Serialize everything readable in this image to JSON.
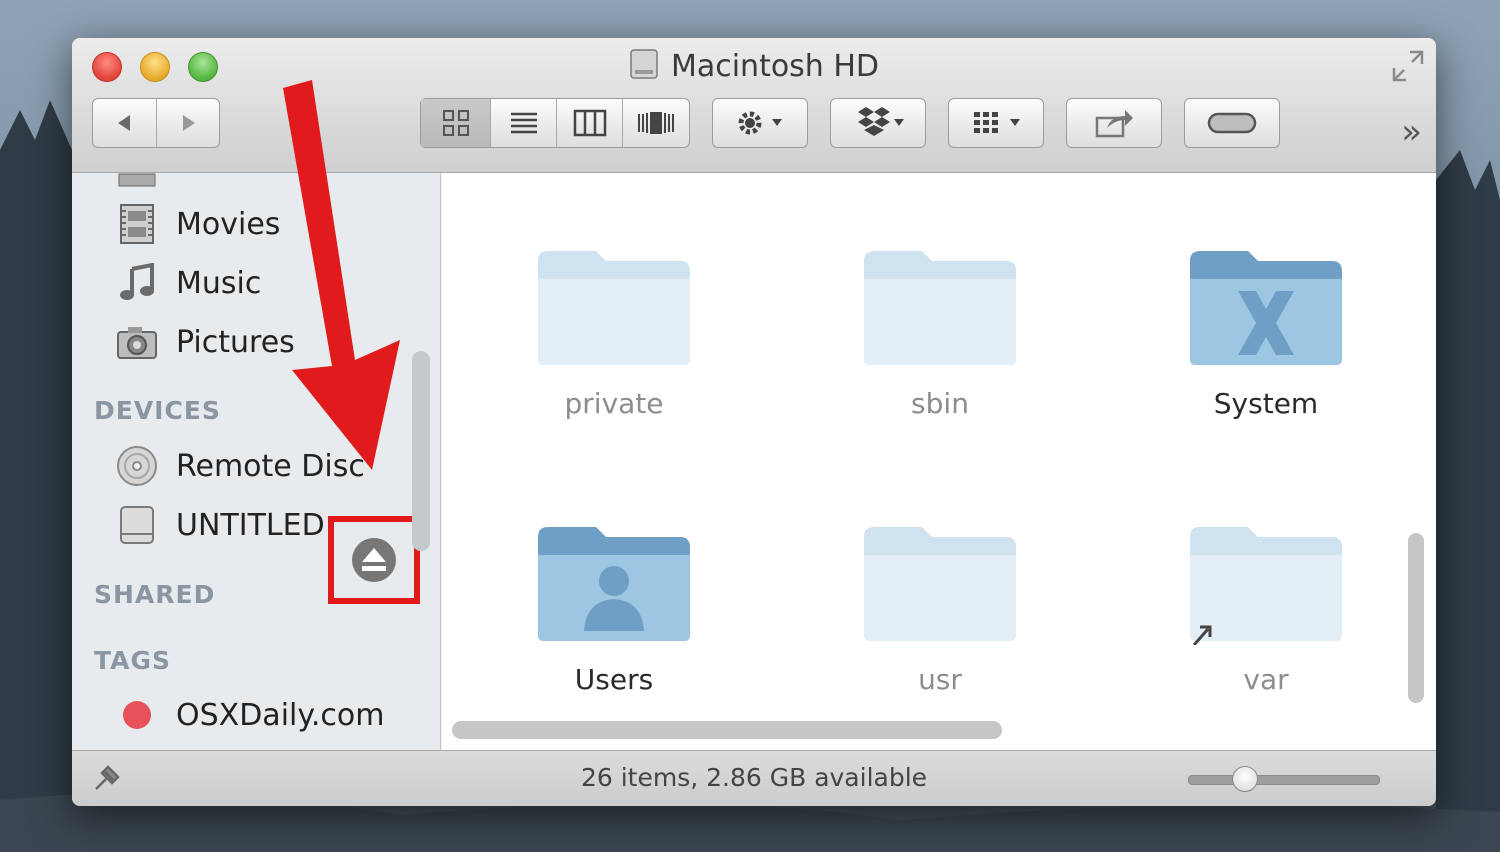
{
  "window": {
    "title": "Macintosh HD"
  },
  "sidebar": {
    "favorites": [
      {
        "label": "Movies",
        "icon": "movies-icon"
      },
      {
        "label": "Music",
        "icon": "music-icon"
      },
      {
        "label": "Pictures",
        "icon": "pictures-icon"
      }
    ],
    "devices_heading": "DEVICES",
    "devices": [
      {
        "label": "Remote Disc",
        "icon": "remote-disc-icon"
      },
      {
        "label": "UNTITLED",
        "icon": "drive-icon"
      }
    ],
    "shared_heading": "SHARED",
    "tags_heading": "TAGS",
    "tags": [
      {
        "label": "OSXDaily.com",
        "color": "#e8505b"
      }
    ]
  },
  "content": {
    "folders": [
      {
        "name": "private",
        "style": "dim"
      },
      {
        "name": "sbin",
        "style": "dim"
      },
      {
        "name": "System",
        "style": "bold"
      },
      {
        "name": "Users",
        "style": "bold"
      },
      {
        "name": "usr",
        "style": "dim"
      },
      {
        "name": "var",
        "style": "dim"
      }
    ]
  },
  "status": {
    "text": "26 items, 2.86 GB available",
    "icon_size_level": 0.26
  },
  "colors": {
    "annotation_red": "#e11b1b",
    "folder_blue": "#9cc6e2"
  }
}
